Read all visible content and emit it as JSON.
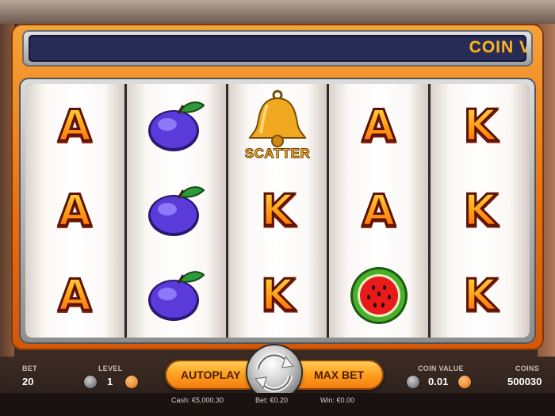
{
  "marquee": {
    "text": "COIN V"
  },
  "reels": [
    [
      "A",
      "A",
      "A"
    ],
    [
      "plum",
      "plum",
      "plum"
    ],
    [
      "scatter",
      "K",
      "K"
    ],
    [
      "A",
      "A",
      "watermelon"
    ],
    [
      "K",
      "K",
      "K"
    ]
  ],
  "scatter_label": "SCATTER",
  "controls": {
    "bet_label": "BET",
    "bet_value": "20",
    "level_label": "LEVEL",
    "level_value": "1",
    "autoplay_label": "AUTOPLAY",
    "maxbet_label": "MAX BET",
    "coin_value_label": "COIN VALUE",
    "coin_value": "0.01",
    "coins_label": "COINS",
    "coins_value": "500030"
  },
  "status": {
    "cash": "Cash: €5,000.30",
    "bet": "Bet: €0.20",
    "win": "Win: €0.00"
  },
  "colors": {
    "accent": "#f07a10",
    "marquee_bg": "#262c55",
    "marquee_text": "#f6b52a"
  }
}
